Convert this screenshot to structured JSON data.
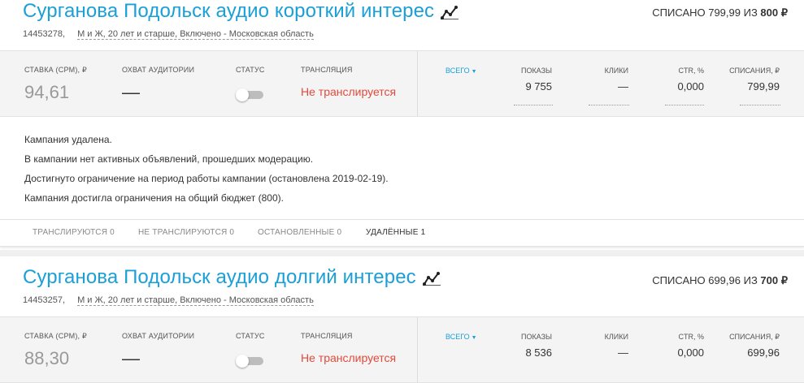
{
  "campaigns": [
    {
      "title": "Сурганова Подольск аудио короткий интерес",
      "title_icon": "stats-chart-icon",
      "spent_prefix": "СПИСАНО 799,99 ИЗ",
      "spent_limit": "800 ₽",
      "id": "14453278,",
      "targeting": "М и Ж, 20 лет и старше, Включено - Московская область",
      "labels": {
        "rate": "СТАВКА (CPM), ₽",
        "reach": "ОХВАТ АУДИТОРИИ",
        "status": "СТАТУС",
        "broadcast": "ТРАНСЛЯЦИЯ",
        "all": "ВСЕГО",
        "shows": "ПОКАЗЫ",
        "clicks": "КЛИКИ",
        "ctr": "CTR, %",
        "charges": "СПИСАНИЯ, ₽"
      },
      "rate": "94,61",
      "reach": "—",
      "status_on": false,
      "broadcast": "Не транслируется",
      "shows": "9 755",
      "clicks": "—",
      "ctr": "0,000",
      "charges": "799,99",
      "messages": [
        "Кампания удалена.",
        "В кампании нет активных объявлений, прошедших модерацию.",
        "Достигнуто ограничение на период работы кампании (остановлена 2019-02-19).",
        "Кампания достигла ограничения на общий бюджет (800)."
      ],
      "tabs": [
        {
          "label": "ТРАНСЛИРУЮТСЯ",
          "count": "0"
        },
        {
          "label": "НЕ ТРАНСЛИРУЮТСЯ",
          "count": "0"
        },
        {
          "label": "ОСТАНОВЛЕННЫЕ",
          "count": "0"
        },
        {
          "label": "УДАЛЁННЫЕ",
          "count": "1"
        }
      ]
    },
    {
      "title": "Сурганова Подольск аудио долгий интерес",
      "title_icon": "stats-chart-icon",
      "spent_prefix": "СПИСАНО 699,96 ИЗ",
      "spent_limit": "700 ₽",
      "id": "14453257,",
      "targeting": "М и Ж, 20 лет и старше, Включено - Московская область",
      "labels": {
        "rate": "СТАВКА (CPM), ₽",
        "reach": "ОХВАТ АУДИТОРИИ",
        "status": "СТАТУС",
        "broadcast": "ТРАНСЛЯЦИЯ",
        "all": "ВСЕГО",
        "shows": "ПОКАЗЫ",
        "clicks": "КЛИКИ",
        "ctr": "CTR, %",
        "charges": "СПИСАНИЯ, ₽"
      },
      "rate": "88,30",
      "reach": "—",
      "status_on": false,
      "broadcast": "Не транслируется",
      "shows": "8 536",
      "clicks": "—",
      "ctr": "0,000",
      "charges": "699,96"
    }
  ],
  "colors": {
    "title": "#1a9fd8",
    "not_broadcasting": "#e04a3c",
    "panel_bg": "#f4f4f4"
  }
}
